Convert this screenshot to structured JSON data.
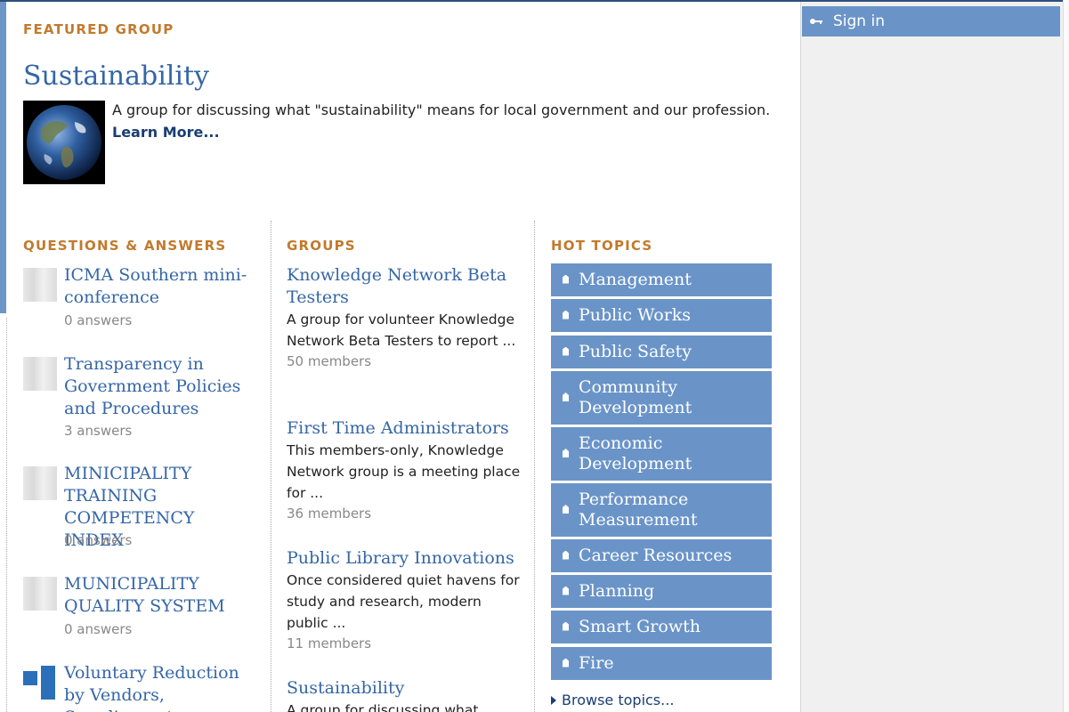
{
  "featured": {
    "label": "FEATURED GROUP",
    "title": "Sustainability",
    "description": "A group for discussing what \"sustainability\" means for local government and our profession.",
    "learn_more": "Learn More..."
  },
  "qa": {
    "label": "QUESTIONS & ANSWERS",
    "items": [
      {
        "title": "ICMA Southern mini-conference",
        "meta": "0 answers"
      },
      {
        "title": "Transparency in Government Policies and Procedures",
        "meta": "3 answers"
      },
      {
        "title": "MINICIPALITY TRAINING COMPETENCY INDEX",
        "meta": "0 answers"
      },
      {
        "title": "MUNICIPALITY QUALITY SYSTEM",
        "meta": "0 answers"
      },
      {
        "title": "Voluntary Reduction by Vendors, Suppliers, etc."
      }
    ]
  },
  "groups": {
    "label": "GROUPS",
    "items": [
      {
        "title": "Knowledge Network Beta Testers",
        "description": "A group for volunteer Knowledge Network Beta Testers to report ...",
        "meta": "50 members"
      },
      {
        "title": "First Time Administrators",
        "description": "This members-only, Knowledge Network group is a meeting place for ...",
        "meta": "36 members"
      },
      {
        "title": "Public Library Innovations",
        "description": "Once considered quiet havens for study and research, modern public ...",
        "meta": "11 members"
      },
      {
        "title": "Sustainability",
        "description": "A group for discussing what"
      }
    ]
  },
  "topics": {
    "label": "HOT TOPICS",
    "items": [
      "Management",
      "Public Works",
      "Public Safety",
      "Community Development",
      "Economic Development",
      "Performance Measurement",
      "Career Resources",
      "Planning",
      "Smart Growth",
      "Fire"
    ],
    "browse": "Browse topics..."
  },
  "sidebar": {
    "sign_in": "Sign in",
    "key_icon": "key-icon"
  },
  "colors": {
    "accent": "#6a94c8",
    "label": "#c27a2c",
    "link": "#3566a6"
  }
}
